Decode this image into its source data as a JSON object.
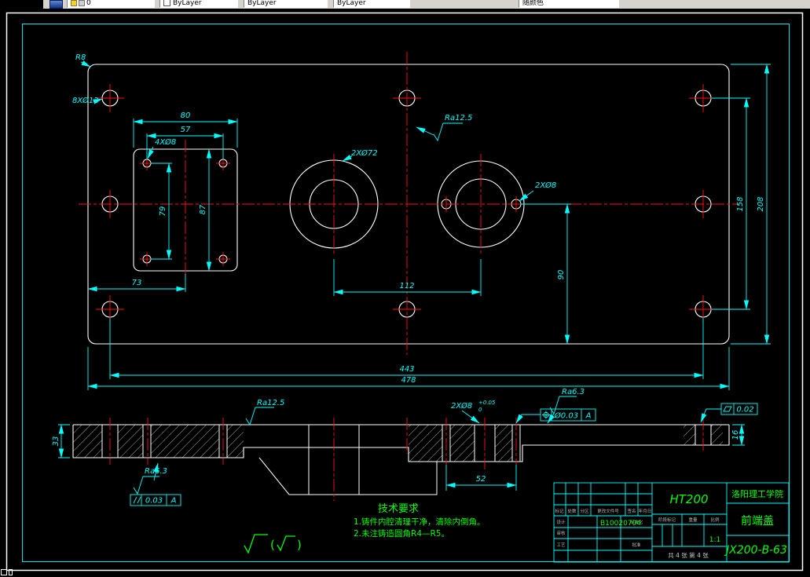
{
  "toolbar": {
    "combos": [
      {
        "value": "0"
      },
      {
        "value": "ByLayer"
      },
      {
        "value": "ByLayer"
      },
      {
        "value": "ByLayer"
      },
      {
        "value": "随颜色"
      }
    ]
  },
  "colors": {
    "background": "#000000",
    "lines": "#ffffff",
    "dimensions": "#00ffff",
    "centerlines": "#ff1111",
    "annotations": "#00ff00",
    "toolbar": "#d6d3ce"
  },
  "drawing": {
    "dims": {
      "r8": "R8",
      "holes8": "8XØ12",
      "d80": "80",
      "d57": "57",
      "holes4": "4XØ8",
      "d79": "79",
      "d87": "87",
      "d73": "73",
      "bores": "2XØ72",
      "holes2": "2XØ8",
      "d112": "112",
      "d90": "90",
      "d158": "158",
      "d208": "208",
      "d443": "443",
      "d478": "478",
      "ra125_top": "Ra12.5",
      "ra125_sec": "Ra12.5",
      "ra63_right": "Ra6.3",
      "ra63_left": "Ra6.3",
      "sec33": "33",
      "sec16": "16",
      "sec52": "52",
      "sec_holes": "2XØ8",
      "tol_sup": "+0.05",
      "tol_sub": "0",
      "pos_tol": "Ø0.03",
      "pos_datum": "A",
      "flat_tol": "0.02",
      "par_tol": "0.03",
      "par_datum": "A"
    },
    "tech_req": {
      "title": "技术要求",
      "line1": "1.铸件内腔清理干净，清除内倒角。",
      "line2": "2.未注铸造圆角R4—R5。"
    },
    "finish": {
      "open": "(",
      "close": ")"
    }
  },
  "title_block": {
    "school": "洛阳理工学院",
    "part_name": "前端盖",
    "drawing_no": "JX200-B-63",
    "material": "HT200",
    "designer_id": "B10020704",
    "scale_value": "1:1",
    "sheet": "共 4 张  第 4 张",
    "labels": {
      "mark": "标记",
      "count": "处数",
      "zone": "分区",
      "doc_no": "更改文件号",
      "sign": "签名",
      "date": "年月日",
      "design": "设计",
      "check": "审核",
      "process": "工艺",
      "standard": "标准化",
      "approve": "批准",
      "stage": "阶段标记",
      "weight": "重量",
      "scale": "比例"
    }
  }
}
